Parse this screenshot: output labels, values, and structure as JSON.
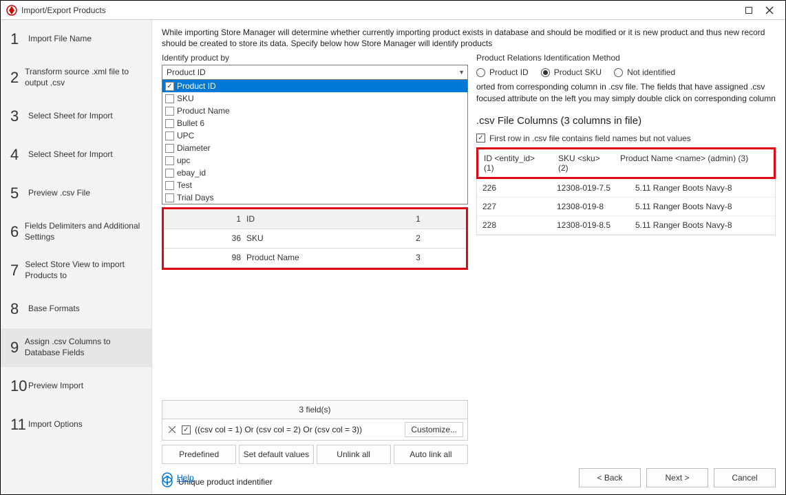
{
  "window": {
    "title": "Import/Export Products"
  },
  "steps": [
    {
      "num": "1",
      "label": "Import File Name"
    },
    {
      "num": "2",
      "label": "Transform source .xml file to output .csv"
    },
    {
      "num": "3",
      "label": "Select Sheet for Import"
    },
    {
      "num": "4",
      "label": "Select Sheet for Import"
    },
    {
      "num": "5",
      "label": "Preview .csv File"
    },
    {
      "num": "6",
      "label": "Fields Delimiters and Additional Settings"
    },
    {
      "num": "7",
      "label": "Select Store View to import Products to"
    },
    {
      "num": "8",
      "label": "Base Formats"
    },
    {
      "num": "9",
      "label": "Assign .csv Columns to Database Fields"
    },
    {
      "num": "10",
      "label": "Preview Import"
    },
    {
      "num": "11",
      "label": "Import Options"
    }
  ],
  "active_step_index": 8,
  "intro": "While importing Store Manager will determine whether currently importing product exists in database and should be modified or it is new product and thus new record should be created to store its data. Specify below how Store Manager will identify products",
  "identify": {
    "label": "Identify product by",
    "selected": "Product ID",
    "options": [
      {
        "label": "Product ID",
        "checked": true
      },
      {
        "label": "SKU",
        "checked": false
      },
      {
        "label": "Product Name",
        "checked": false
      },
      {
        "label": "Bullet 6",
        "checked": false
      },
      {
        "label": "UPC",
        "checked": false
      },
      {
        "label": "Diameter",
        "checked": false
      },
      {
        "label": "upc",
        "checked": false
      },
      {
        "label": "ebay_id",
        "checked": false
      },
      {
        "label": "Test",
        "checked": false
      },
      {
        "label": "Trial Days",
        "checked": false
      }
    ]
  },
  "mapping": {
    "rows": [
      {
        "idx": "1",
        "name": "ID",
        "col": "1"
      },
      {
        "idx": "36",
        "name": "SKU",
        "col": "2"
      },
      {
        "idx": "98",
        "name": "Product Name",
        "col": "3"
      }
    ],
    "count_text": "3 field(s)"
  },
  "filter": {
    "expr": "((csv col = 1) Or (csv col = 2) Or (csv col = 3))",
    "customize": "Customize..."
  },
  "action_buttons": {
    "predefined": "Predefined",
    "set_defaults": "Set default values",
    "unlink_all": "Unlink all",
    "autolink_all": "Auto link all"
  },
  "uniq_label": "Unique product indentifier",
  "relations": {
    "title": "Product Relations Identification Method",
    "options": [
      {
        "label": "Product ID",
        "checked": false
      },
      {
        "label": "Product SKU",
        "checked": true
      },
      {
        "label": "Not identified",
        "checked": false
      }
    ]
  },
  "note": "orted from corresponding column in .csv file. The fields that have assigned .csv focused attribute on the left you may simply double click on corresponding column",
  "csv": {
    "title": ".csv File Columns (3 columns in file)",
    "first_row_label": "First row in .csv file contains field names but not values",
    "first_row_checked": true,
    "headers": [
      "ID <entity_id> (1)",
      "SKU <sku> (2)",
      "Product Name <name> (admin) (3)"
    ],
    "rows": [
      {
        "c1": "226",
        "c2": "12308-019-7.5",
        "c3": "5.11 Ranger Boots Navy-8"
      },
      {
        "c1": "227",
        "c2": "12308-019-8",
        "c3": "5.11 Ranger Boots Navy-8"
      },
      {
        "c1": "228",
        "c2": "12308-019-8.5",
        "c3": "5.11 Ranger Boots Navy-8"
      }
    ]
  },
  "footer": {
    "help": "Help",
    "back": "< Back",
    "next": "Next >",
    "cancel": "Cancel"
  }
}
